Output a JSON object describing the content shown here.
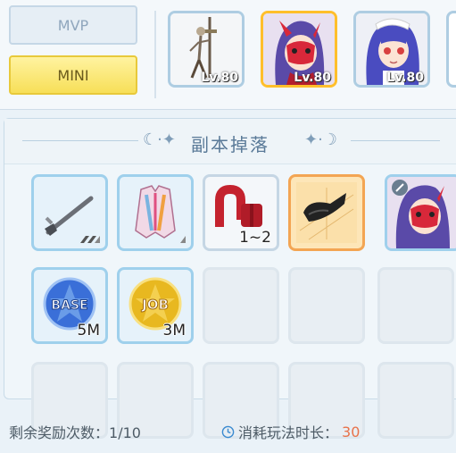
{
  "tabs": {
    "mvp_label": "MVP",
    "mini_label": "MINI",
    "selected": "MINI"
  },
  "bosses": [
    {
      "name": "skeleton-swordsman",
      "level": "Lv.80",
      "selected": false
    },
    {
      "name": "red-mask-girl",
      "level": "Lv.80",
      "selected": true
    },
    {
      "name": "maid-girl",
      "level": "Lv.80",
      "selected": false
    }
  ],
  "drops": {
    "title": "副本掉落",
    "items": [
      {
        "name": "pickaxe-tool",
        "qty": ""
      },
      {
        "name": "colorful-jacket",
        "qty": ""
      },
      {
        "name": "red-ribbon",
        "qty": "1~2"
      },
      {
        "name": "black-headband-card",
        "qty": ""
      },
      {
        "name": "red-mask-headgear",
        "qty": ""
      },
      {
        "name": "base-exp-token",
        "qty": "5M"
      },
      {
        "name": "job-exp-token",
        "qty": "3M"
      }
    ],
    "token_labels": {
      "base": "BASE",
      "job": "JOB"
    }
  },
  "footer": {
    "remaining_label": "剩余奖励次数：",
    "remaining_value": "1/10",
    "time_label": "消耗玩法时长：",
    "time_value": "30"
  },
  "colors": {
    "accent": "#ffbf2b",
    "highlight": "#e8724a",
    "title": "#5a7a98"
  }
}
